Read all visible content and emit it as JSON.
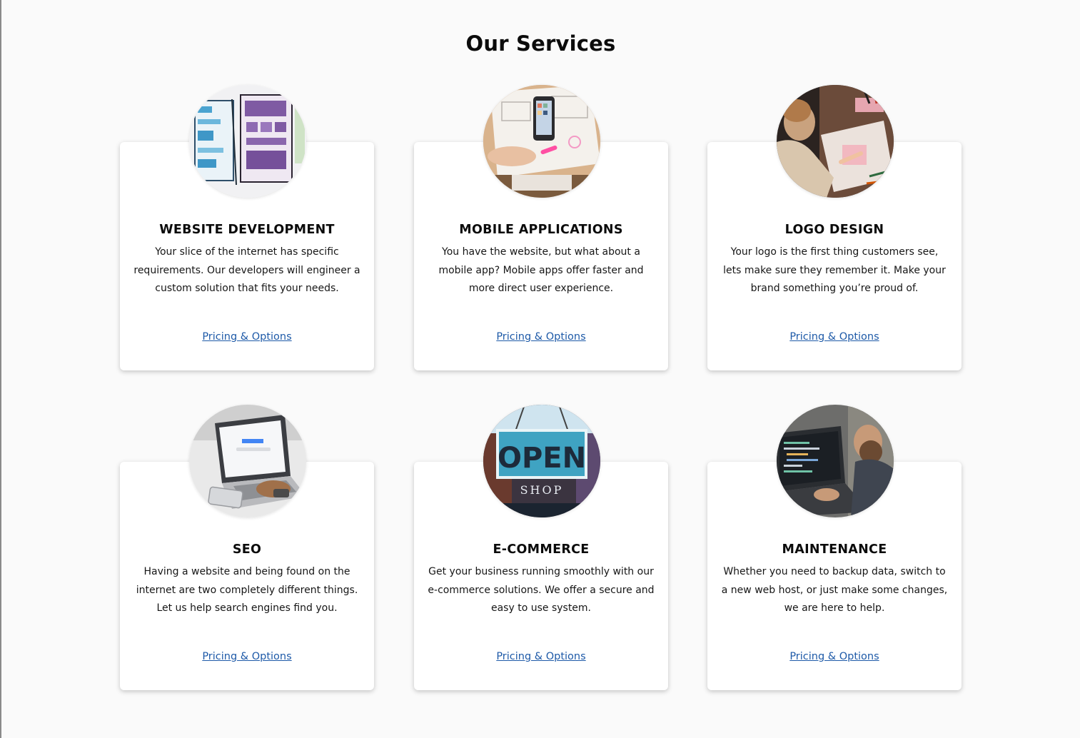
{
  "section": {
    "title": "Our Services"
  },
  "cards": [
    {
      "title": "WEBSITE DEVELOPMENT",
      "description": "Your slice of the internet has specific requirements. Our developers will engineer a custom solution that fits your needs.",
      "link": "Pricing & Options",
      "image": "wireframe-sketch-image"
    },
    {
      "title": "MOBILE APPLICATIONS",
      "description": "You have the website, but what about a mobile app? Mobile apps offer faster and more direct user experience.",
      "link": "Pricing & Options",
      "image": "phone-on-desk-image"
    },
    {
      "title": "LOGO DESIGN",
      "description": "Your logo is the first thing customers see, lets make sure they remember it. Make your brand something you’re proud of.",
      "link": "Pricing & Options",
      "image": "designer-drawing-image"
    },
    {
      "title": "SEO",
      "description": "Having a website and being found on the internet are two completely different things. Let us help search engines find you.",
      "link": "Pricing & Options",
      "image": "laptop-search-image"
    },
    {
      "title": "E-COMMERCE",
      "description": "Get your business running smoothly with our e-commerce solutions. We offer a secure and easy to use system.",
      "link": "Pricing & Options",
      "image": "open-shop-sign-image",
      "image_text": {
        "sign": "OPEN",
        "sub": "SHOP"
      }
    },
    {
      "title": "MAINTENANCE",
      "description": "Whether you need to backup data, switch to a new web host, or just make some changes, we are here to help.",
      "link": "Pricing & Options",
      "image": "developer-laptop-image"
    }
  ],
  "colors": {
    "link": "#1e5aa8",
    "background": "#fafafa",
    "card": "#ffffff"
  }
}
